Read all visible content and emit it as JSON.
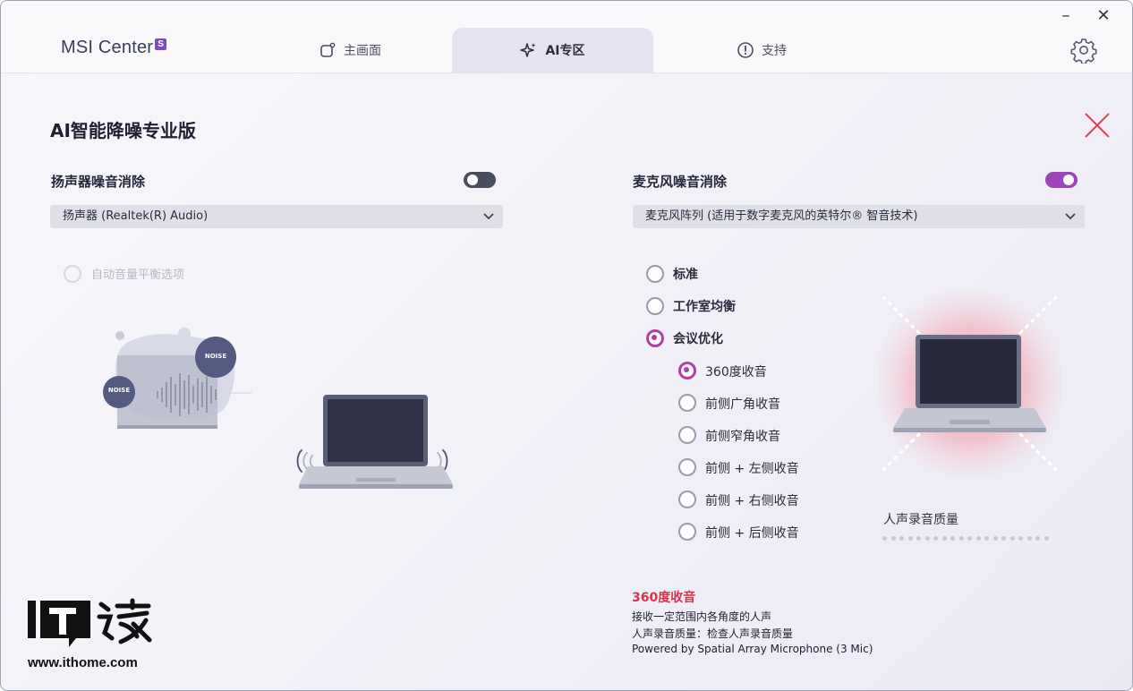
{
  "app": {
    "name": "MSI Center",
    "badge": "S"
  },
  "tabs": [
    {
      "label": "主画面",
      "icon": "home-icon",
      "active": false
    },
    {
      "label": "AI专区",
      "icon": "sparkle-icon",
      "active": true
    },
    {
      "label": "支持",
      "icon": "alert-circle-icon",
      "active": false
    }
  ],
  "window_controls": {
    "minimize": "–",
    "close": "✕"
  },
  "page": {
    "title": "AI智能降噪专业版"
  },
  "speaker": {
    "label": "扬声器噪音消除",
    "enabled": false,
    "device": "扬声器 (Realtek(R) Audio)",
    "auto_balance_label": "自动音量平衡选项",
    "noise_badge_1": "NOISE",
    "noise_badge_2": "NOISE"
  },
  "mic": {
    "label": "麦克风噪音消除",
    "enabled": true,
    "device": "麦克风阵列 (适用于数字麦克风的英特尔® 智音技术)",
    "modes": [
      {
        "label": "标准",
        "selected": false
      },
      {
        "label": "工作室均衡",
        "selected": false
      },
      {
        "label": "会议优化",
        "selected": true
      }
    ],
    "sub_modes": [
      {
        "label": "360度收音",
        "selected": true
      },
      {
        "label": "前侧广角收音",
        "selected": false
      },
      {
        "label": "前侧窄角收音",
        "selected": false
      },
      {
        "label": "前侧 + 左侧收音",
        "selected": false
      },
      {
        "label": "前侧 + 右侧收音",
        "selected": false
      },
      {
        "label": "前侧 + 后侧收音",
        "selected": false
      }
    ],
    "quality_label": "人声录音质量"
  },
  "info": {
    "title": "360度收音",
    "line1": "接收一定范围内各角度的人声",
    "line2": "人声录音质量：检查人声录音质量",
    "line3": "Powered by Spatial Array Microphone (3 Mic)"
  },
  "watermark": {
    "text": "www.ithome.com",
    "logo_text": "IT之家"
  },
  "colors": {
    "accent": "#b23fa8",
    "toggle_on": "#9b45b8",
    "toggle_off": "#4a4d5e",
    "info_title": "#d9324b"
  }
}
